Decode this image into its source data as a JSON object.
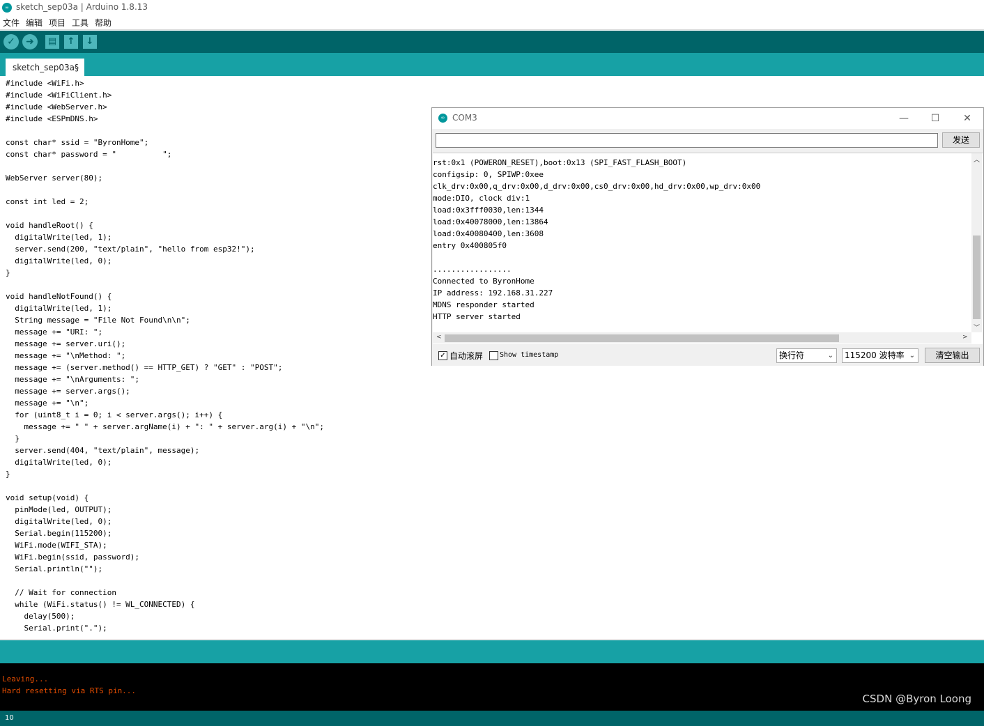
{
  "window": {
    "title": "sketch_sep03a | Arduino 1.8.13",
    "logo": "∞"
  },
  "menu": [
    "文件",
    "编辑",
    "项目",
    "工具",
    "帮助"
  ],
  "toolbar": {
    "verify": "✓",
    "upload": "➜",
    "new": "▤",
    "open": "↑",
    "save": "↓"
  },
  "tab": {
    "label": "sketch_sep03a§"
  },
  "code": [
    "#include <WiFi.h>",
    "#include <WiFiClient.h>",
    "#include <WebServer.h>",
    "#include <ESPmDNS.h>",
    "",
    "const char* ssid = \"ByronHome\";",
    "const char* password = \"          \";",
    "",
    "WebServer server(80);",
    "",
    "const int led = 2;",
    "",
    "void handleRoot() {",
    "  digitalWrite(led, 1);",
    "  server.send(200, \"text/plain\", \"hello from esp32!\");",
    "  digitalWrite(led, 0);",
    "}",
    "",
    "void handleNotFound() {",
    "  digitalWrite(led, 1);",
    "  String message = \"File Not Found\\n\\n\";",
    "  message += \"URI: \";",
    "  message += server.uri();",
    "  message += \"\\nMethod: \";",
    "  message += (server.method() == HTTP_GET) ? \"GET\" : \"POST\";",
    "  message += \"\\nArguments: \";",
    "  message += server.args();",
    "  message += \"\\n\";",
    "  for (uint8_t i = 0; i < server.args(); i++) {",
    "    message += \" \" + server.argName(i) + \": \" + server.arg(i) + \"\\n\";",
    "  }",
    "  server.send(404, \"text/plain\", message);",
    "  digitalWrite(led, 0);",
    "}",
    "",
    "void setup(void) {",
    "  pinMode(led, OUTPUT);",
    "  digitalWrite(led, 0);",
    "  Serial.begin(115200);",
    "  WiFi.mode(WIFI_STA);",
    "  WiFi.begin(ssid, password);",
    "  Serial.println(\"\");",
    "",
    "  // Wait for connection",
    "  while (WiFi.status() != WL_CONNECTED) {",
    "    delay(500);",
    "    Serial.print(\".\");"
  ],
  "console": {
    "lines": [
      "Leaving...",
      "Hard resetting via RTS pin..."
    ]
  },
  "status": {
    "line_number": "10"
  },
  "serial_monitor": {
    "title": "COM3",
    "logo": "∞",
    "minimize": "—",
    "maximize": "☐",
    "close": "✕",
    "input_value": "",
    "send_label": "发送",
    "output": [
      "rst:0x1 (POWERON_RESET),boot:0x13 (SPI_FAST_FLASH_BOOT)",
      "configsip: 0, SPIWP:0xee",
      "clk_drv:0x00,q_drv:0x00,d_drv:0x00,cs0_drv:0x00,hd_drv:0x00,wp_drv:0x00",
      "mode:DIO, clock div:1",
      "load:0x3fff0030,len:1344",
      "load:0x40078000,len:13864",
      "load:0x40080400,len:3608",
      "entry 0x400805f0",
      "",
      ".................",
      "Connected to ByronHome",
      "IP address: 192.168.31.227",
      "MDNS responder started",
      "HTTP server started"
    ],
    "scroll_up": "︿",
    "scroll_down": "﹀",
    "scroll_left": "<",
    "scroll_right": ">",
    "autoscroll_checked": "✓",
    "autoscroll_label": "自动滚屏",
    "timestamp_checked": "",
    "timestamp_label": "Show timestamp",
    "line_ending": "换行符",
    "baud_rate": "115200 波特率",
    "dropdown_arrow": "⌄",
    "clear_label": "清空输出"
  },
  "watermark": "CSDN @Byron Loong",
  "colors": {
    "toolbar": "#006468",
    "tabbar": "#17a1a5",
    "keyword": "#00979c",
    "function": "#d35400",
    "console_text": "#e34c00"
  }
}
